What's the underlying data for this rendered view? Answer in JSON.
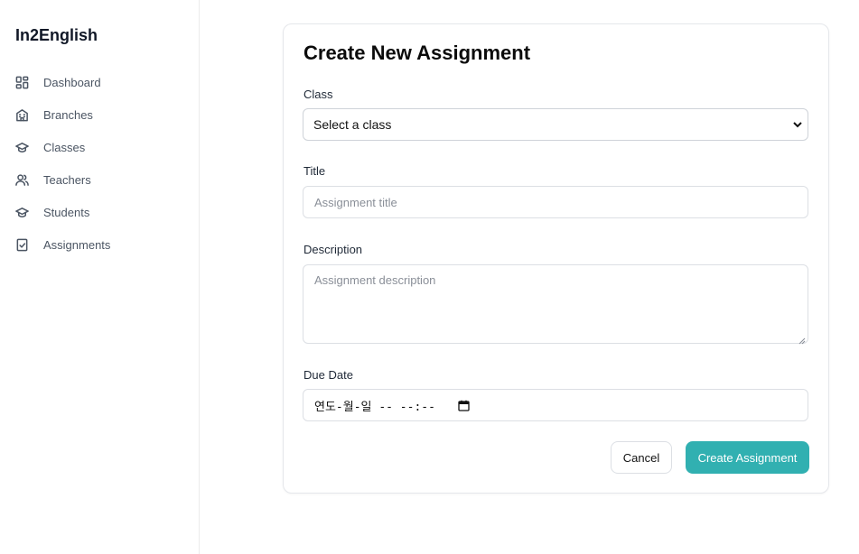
{
  "app": {
    "brand": "In2English"
  },
  "sidebar": {
    "items": [
      {
        "label": "Dashboard",
        "icon": "dashboard-icon"
      },
      {
        "label": "Branches",
        "icon": "building-icon"
      },
      {
        "label": "Classes",
        "icon": "graduation-cap-icon"
      },
      {
        "label": "Teachers",
        "icon": "users-icon"
      },
      {
        "label": "Students",
        "icon": "graduation-cap-icon"
      },
      {
        "label": "Assignments",
        "icon": "clipboard-check-icon"
      }
    ]
  },
  "form": {
    "title": "Create New Assignment",
    "class": {
      "label": "Class",
      "value": "Select a class"
    },
    "title_field": {
      "label": "Title",
      "placeholder": "Assignment title"
    },
    "description": {
      "label": "Description",
      "placeholder": "Assignment description"
    },
    "due_date": {
      "label": "Due Date",
      "value": "연도-월-일 -- --:--"
    },
    "cancel_label": "Cancel",
    "submit_label": "Create Assignment"
  },
  "colors": {
    "accent": "#31b0b1",
    "border": "#dcdfe4",
    "text": "#1f2937"
  }
}
